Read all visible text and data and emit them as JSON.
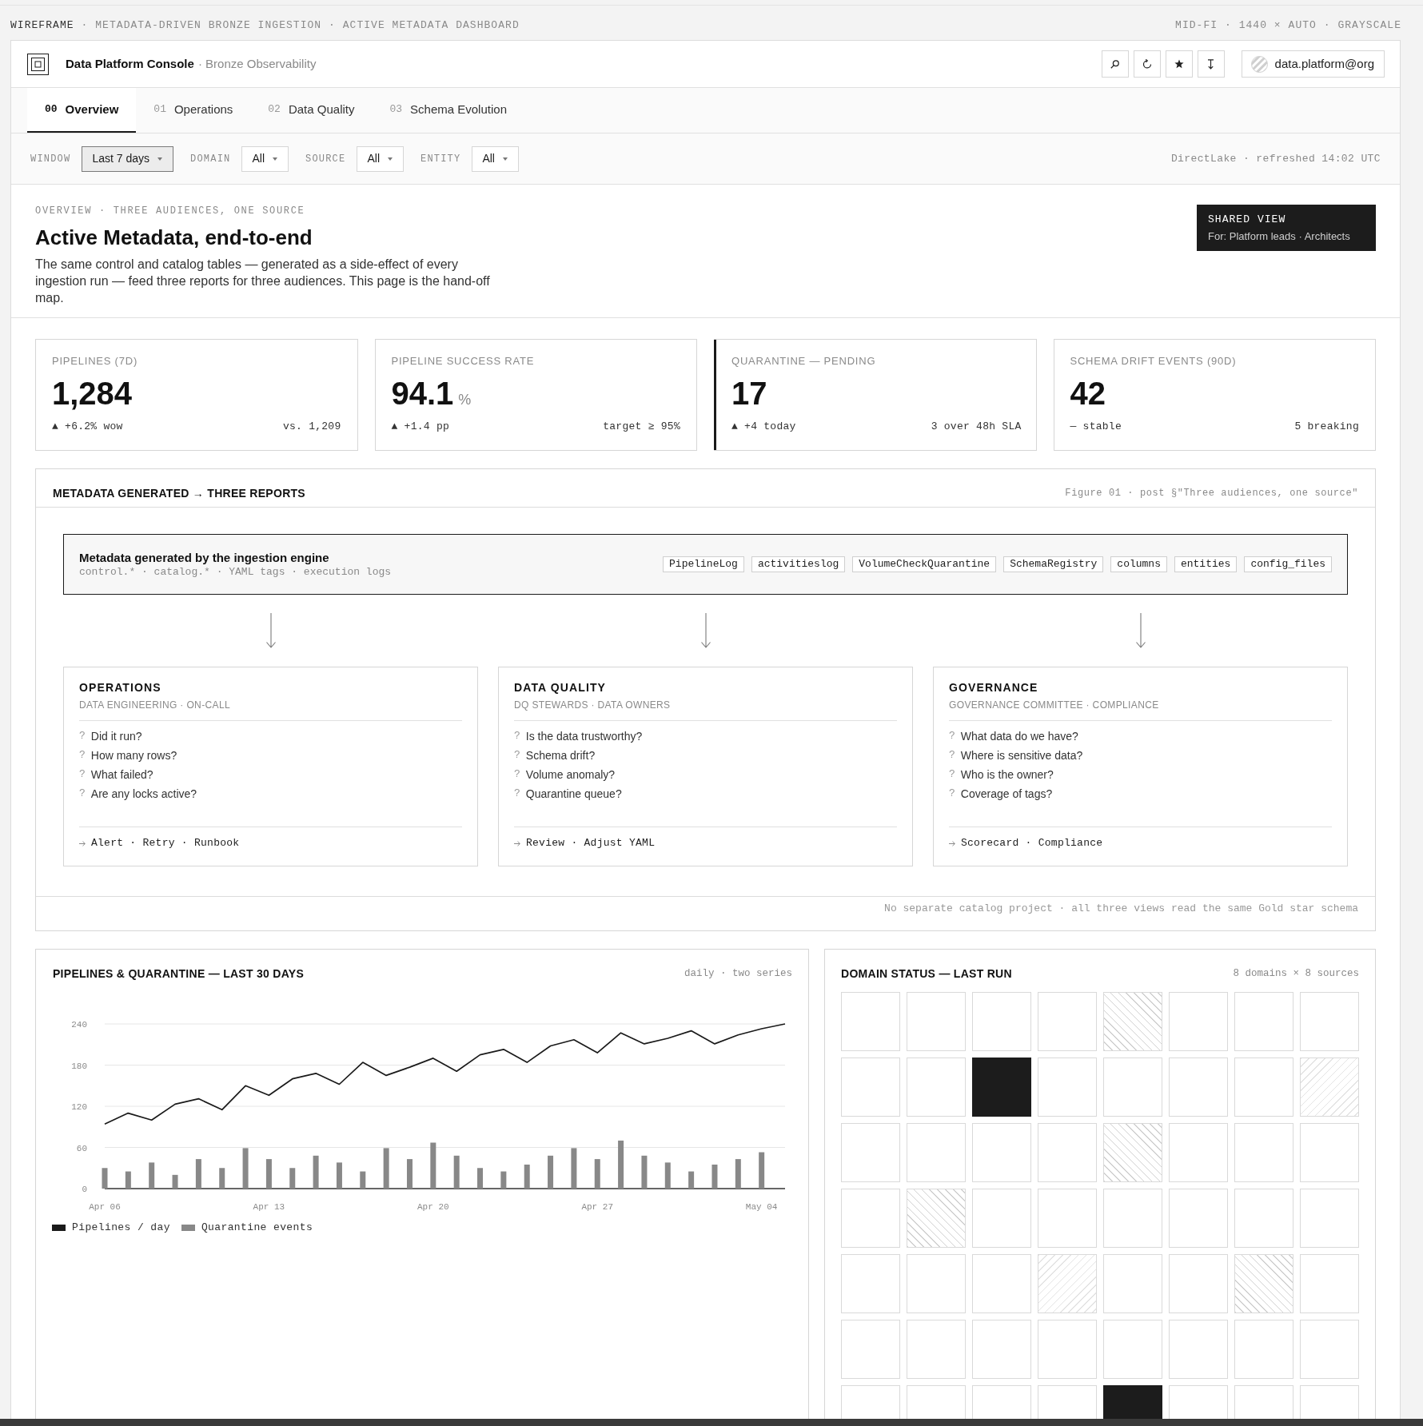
{
  "caption": {
    "label": "WIREFRAME",
    "text": "· METADATA-DRIVEN BRONZE INGESTION · ACTIVE METADATA DASHBOARD",
    "meta": "MID-FI · 1440 × AUTO · GRAYSCALE"
  },
  "header": {
    "title": "Data Platform Console",
    "subtitle": "· Bronze Observability",
    "user": "data.platform@org"
  },
  "tabs": [
    {
      "index": "00",
      "label": "Overview",
      "selected": true
    },
    {
      "index": "01",
      "label": "Operations",
      "selected": false
    },
    {
      "index": "02",
      "label": "Data Quality",
      "selected": false
    },
    {
      "index": "03",
      "label": "Schema Evolution",
      "selected": false
    }
  ],
  "filters": {
    "items": [
      {
        "label": "WINDOW",
        "value": "Last 7 days",
        "selected": true
      },
      {
        "label": "DOMAIN",
        "value": "All",
        "selected": false
      },
      {
        "label": "SOURCE",
        "value": "All",
        "selected": false
      },
      {
        "label": "ENTITY",
        "value": "All",
        "selected": false
      }
    ],
    "status": "DirectLake · refreshed 14:02 UTC"
  },
  "overview": {
    "overline": "OVERVIEW · THREE AUDIENCES, ONE SOURCE",
    "title": "Active Metadata, end-to-end",
    "description": "The same control and catalog tables — generated as a side-effect of every ingestion run — feed three reports for three audiences. This page is the hand-off map.",
    "badge": {
      "title": "SHARED VIEW",
      "text": "For: Platform leads · Architects"
    }
  },
  "kpis": [
    {
      "label": "PIPELINES (7D)",
      "value": "1,284",
      "delta": "▲ +6.2% wow",
      "note": "vs. 1,209",
      "highlighted": false
    },
    {
      "label": "PIPELINE SUCCESS RATE",
      "value": "94.1",
      "unit": "%",
      "delta": "▲ +1.4 pp",
      "note": "target ≥ 95%",
      "highlighted": false
    },
    {
      "label": "QUARANTINE — PENDING",
      "value": "17",
      "delta": "▲ +4 today",
      "note": "3 over 48h SLA",
      "highlighted": true
    },
    {
      "label": "SCHEMA DRIFT EVENTS (90D)",
      "value": "42",
      "delta": "— stable",
      "note": "5 breaking",
      "highlighted": false
    }
  ],
  "figure": {
    "title": "METADATA GENERATED → THREE REPORTS",
    "caption": "Figure 01 · post §\"Three audiences, one source\"",
    "source": {
      "title": "Metadata generated by the ingestion engine",
      "subtitle": "control.* · catalog.* · YAML tags · execution logs",
      "tags": [
        "PipelineLog",
        "activitieslog",
        "VolumeCheckQuarantine",
        "SchemaRegistry",
        "columns",
        "entities",
        "config_files"
      ]
    },
    "reports": [
      {
        "title": "OPERATIONS",
        "audience": "DATA ENGINEERING · ON-CALL",
        "questions": [
          {
            "mark": "?",
            "text": "Did it run?"
          },
          {
            "mark": "?",
            "text": "How many rows?"
          },
          {
            "mark": "?",
            "text": "What failed?"
          },
          {
            "mark": "?",
            "text": "Are any locks active?"
          }
        ],
        "actions": "Alert · Retry · Runbook"
      },
      {
        "title": "DATA QUALITY",
        "audience": "DQ STEWARDS · DATA OWNERS",
        "questions": [
          {
            "mark": "?",
            "text": "Is the data trustworthy?"
          },
          {
            "mark": "?",
            "text": "Schema drift?"
          },
          {
            "mark": "?",
            "text": "Volume anomaly?"
          },
          {
            "mark": "?",
            "text": "Quarantine queue?"
          }
        ],
        "actions": "Review · Adjust YAML"
      },
      {
        "title": "GOVERNANCE",
        "audience": "GOVERNANCE COMMITTEE · COMPLIANCE",
        "questions": [
          {
            "mark": "?",
            "text": "What data do we have?"
          },
          {
            "mark": "?",
            "text": "Where is sensitive data?"
          },
          {
            "mark": "?",
            "text": "Who is the owner?"
          },
          {
            "mark": "?",
            "text": "Coverage of tags?"
          }
        ],
        "actions": "Scorecard · Compliance"
      }
    ],
    "footer": "No separate catalog project · all three views read the same Gold star schema"
  },
  "trend": {
    "title": "PIPELINES & QUARANTINE — LAST 30 DAYS",
    "caption": "daily · two series",
    "chart_data": {
      "type": "line",
      "grid": true,
      "ylim": [
        0,
        240
      ],
      "yticks": [
        0,
        60,
        120,
        180,
        240
      ],
      "categories": [
        "Apr 06",
        null,
        null,
        null,
        null,
        null,
        null,
        "Apr 13",
        null,
        null,
        null,
        null,
        null,
        null,
        "Apr 20",
        null,
        null,
        null,
        null,
        null,
        null,
        "Apr 27",
        null,
        null,
        null,
        null,
        null,
        null,
        "May 04",
        null
      ],
      "series": [
        {
          "name": "Pipelines / day",
          "color": "#1a1a1a",
          "values": [
            94,
            110,
            100,
            123,
            131,
            115,
            150,
            136,
            160,
            168,
            152,
            184,
            165,
            177,
            190,
            171,
            195,
            203,
            184,
            208,
            217,
            198,
            227,
            211,
            219,
            230,
            211,
            224,
            233,
            240
          ]
        },
        {
          "name": "Quarantine events",
          "type": "bar",
          "color": "#888888",
          "values": [
            30,
            25,
            38,
            20,
            43,
            30,
            59,
            43,
            30,
            48,
            38,
            25,
            59,
            43,
            67,
            48,
            30,
            25,
            35,
            48,
            59,
            43,
            70,
            48,
            38,
            25,
            35,
            43,
            53,
            null
          ]
        }
      ]
    }
  },
  "domain_status": {
    "title": "DOMAIN STATUS — LAST RUN",
    "caption": "8 domains × 8 sources",
    "rows": [
      [
        {
          "kind": "empty"
        },
        {
          "kind": "empty"
        },
        {
          "kind": "empty"
        },
        {
          "kind": "empty"
        },
        {
          "kind": "hatched"
        },
        {
          "kind": "empty"
        },
        {
          "kind": "empty"
        },
        {
          "kind": "empty"
        }
      ],
      [
        {
          "kind": "empty"
        },
        {
          "kind": "empty"
        },
        {
          "kind": "solid"
        },
        {
          "kind": "empty"
        },
        {
          "kind": "empty"
        },
        {
          "kind": "empty"
        },
        {
          "kind": "empty"
        },
        {
          "kind": "light-hatched"
        }
      ],
      [
        {
          "kind": "empty"
        },
        {
          "kind": "empty"
        },
        {
          "kind": "empty"
        },
        {
          "kind": "empty"
        },
        {
          "kind": "hatched"
        },
        {
          "kind": "empty"
        },
        {
          "kind": "empty"
        },
        {
          "kind": "empty"
        }
      ],
      [
        {
          "kind": "empty"
        },
        {
          "kind": "hatched"
        },
        {
          "kind": "empty"
        },
        {
          "kind": "empty"
        },
        {
          "kind": "empty"
        },
        {
          "kind": "empty"
        },
        {
          "kind": "empty"
        },
        {
          "kind": "empty"
        }
      ],
      [
        {
          "kind": "empty"
        },
        {
          "kind": "empty"
        },
        {
          "kind": "empty"
        },
        {
          "kind": "light-hatched"
        },
        {
          "kind": "empty"
        },
        {
          "kind": "empty"
        },
        {
          "kind": "hatched"
        },
        {
          "kind": "empty"
        }
      ],
      [
        {
          "kind": "empty"
        },
        {
          "kind": "empty"
        },
        {
          "kind": "empty"
        },
        {
          "kind": "empty"
        },
        {
          "kind": "empty"
        },
        {
          "kind": "empty"
        },
        {
          "kind": "empty"
        },
        {
          "kind": "empty"
        }
      ],
      [
        {
          "kind": "empty"
        },
        {
          "kind": "empty"
        },
        {
          "kind": "empty"
        },
        {
          "kind": "empty"
        },
        {
          "kind": "solid"
        },
        {
          "kind": "empty"
        },
        {
          "kind": "empty"
        },
        {
          "kind": "empty"
        }
      ]
    ]
  }
}
